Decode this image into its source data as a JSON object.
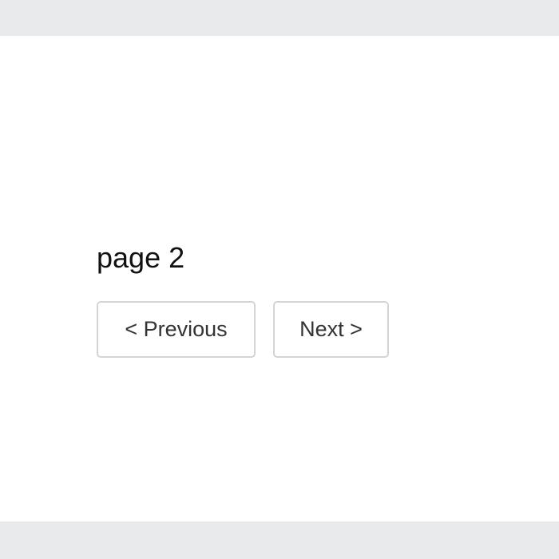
{
  "main": {
    "page_label": "page 2",
    "previous_label": "< Previous",
    "next_label": "Next >"
  }
}
